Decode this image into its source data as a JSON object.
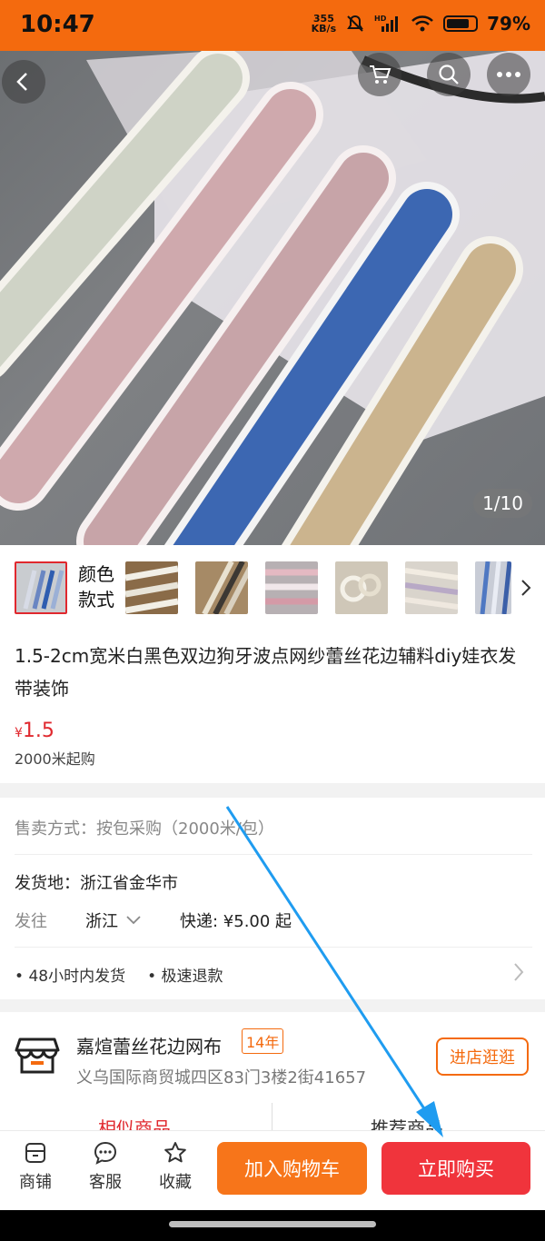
{
  "status": {
    "time": "10:47",
    "net_speed_value": "355",
    "net_speed_unit": "KB/s",
    "battery": "79%",
    "battery_level": 0.79
  },
  "gallery": {
    "counter": "1/10"
  },
  "variants": {
    "label_line1": "颜色",
    "label_line2": "款式"
  },
  "product": {
    "title": "1.5-2cm宽米白黑色双边狗牙波点网纱蕾丝花边辅料diy娃衣发带装饰",
    "price_symbol": "¥",
    "price": "1.5",
    "min_order": "2000米起购"
  },
  "sale": {
    "label": "售卖方式：",
    "value": "按包采购（2000米/包）"
  },
  "shipping": {
    "origin_label": "发货地：",
    "origin_value": "浙江省金华市",
    "to_label": "发往",
    "to_value": "浙江",
    "express": "快递: ¥5.00 起",
    "service_1": "48小时内发货",
    "service_2": "极速退款"
  },
  "shop": {
    "name": "嘉煊蕾丝花边网布",
    "years": "14年",
    "address": "义乌国际商贸城四区83门3楼2街41657",
    "enter_button": "进店逛逛"
  },
  "tabs": {
    "similar": "相似商品",
    "recommended": "推荐商品"
  },
  "bottom_bar": {
    "shop": "商铺",
    "service": "客服",
    "favorite": "收藏",
    "add_to_cart": "加入购物车",
    "buy_now": "立即购买"
  },
  "colors": {
    "brand_orange": "#f46a0e",
    "buy_red": "#f0343c",
    "cart_orange": "#f7751a",
    "price_red": "#e0282e",
    "arrow_blue": "#1f9cf0"
  }
}
